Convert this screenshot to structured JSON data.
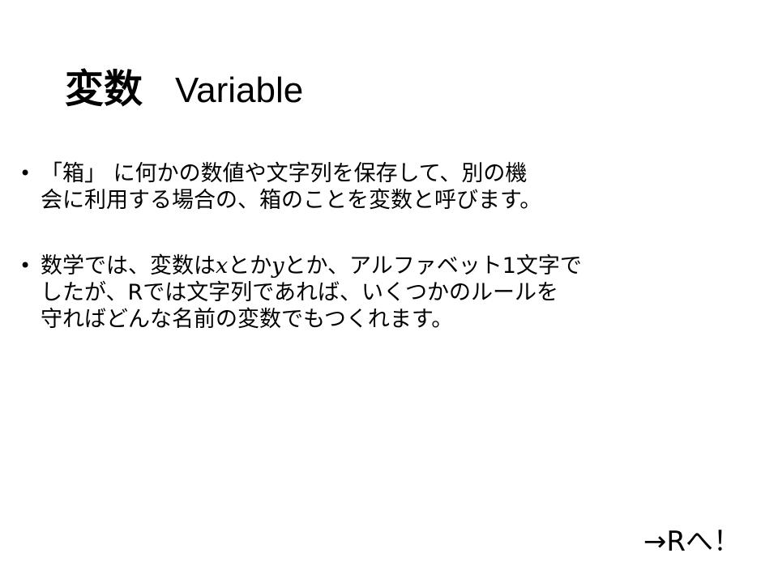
{
  "title": {
    "japanese": "変数",
    "english": "Variable"
  },
  "bullets": [
    {
      "marker": "•",
      "lines": [
        "「箱」 に何かの数値や文字列を保存して、別の機",
        "会に利用する場合の、箱のことを変数と呼びます。"
      ]
    },
    {
      "marker": "•",
      "line1": {
        "a": "数学では、変数は",
        "x": "𝑥",
        "b": "とか",
        "y": "𝑦",
        "c": "とか、アルファベット1文字で"
      },
      "lines": [
        "したが、Rでは文字列であれば、いくつかのルールを",
        "守ればどんな名前の変数でもつくれます。"
      ]
    }
  ],
  "footer": {
    "link": "→Rへ！"
  }
}
